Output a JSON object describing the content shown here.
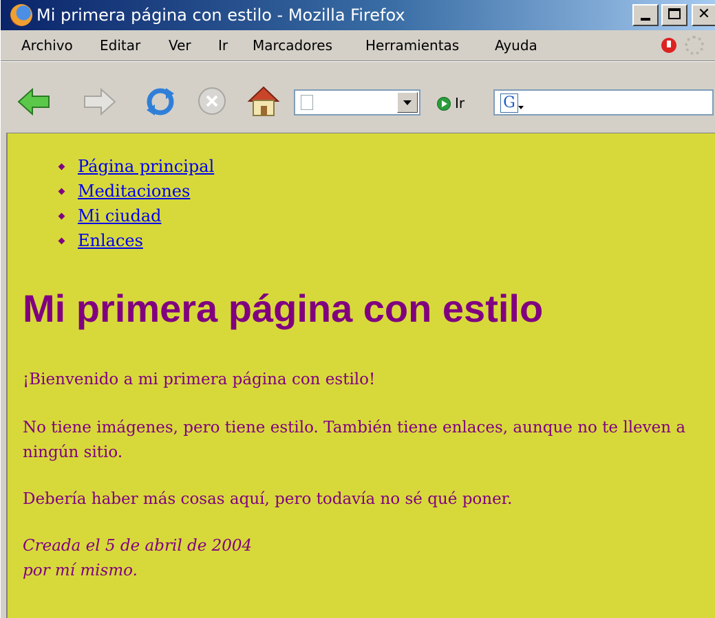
{
  "window": {
    "title": "Mi primera página con estilo - Mozilla Firefox"
  },
  "menubar": {
    "items": [
      "Archivo",
      "Editar",
      "Ver",
      "Ir",
      "Marcadores",
      "Herramientas",
      "Ayuda"
    ]
  },
  "toolbar": {
    "url_value": "",
    "go_label": "Ir",
    "search_value": ""
  },
  "page": {
    "background": "#d7d93a",
    "text_color": "#800080",
    "link_color": "#0000ee",
    "nav_links": [
      "Página principal",
      "Meditaciones",
      "Mi ciudad",
      "Enlaces"
    ],
    "heading": "Mi primera página con estilo",
    "paragraphs": [
      "¡Bienvenido a mi primera página con estilo!",
      "No tiene imágenes, pero tiene estilo. También tiene enlaces, aunque no te lleven a ningún sitio.",
      "Debería haber más cosas aquí, pero todavía no sé qué poner."
    ],
    "footer_lines": [
      "Creada el 5 de abril de 2004",
      "por mí mismo."
    ]
  }
}
